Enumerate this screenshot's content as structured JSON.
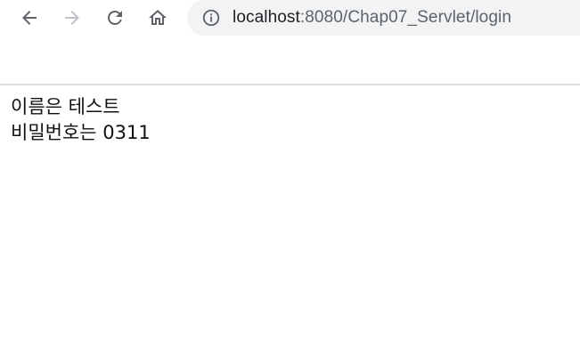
{
  "browser": {
    "address_host": "localhost",
    "address_path": ":8080/Chap07_Servlet/login",
    "icons": {
      "back": "arrow-left-icon",
      "forward": "arrow-right-icon",
      "reload": "reload-icon",
      "home": "home-icon",
      "site_info": "info-icon"
    },
    "colors": {
      "icon_active": "#5f6368",
      "icon_disabled": "#bdc1c6",
      "omnibox_bg": "#f1f3f4",
      "divider": "#dadce0"
    }
  },
  "page": {
    "lines": [
      "이름은 테스트",
      "비밀번호는 0311"
    ]
  }
}
